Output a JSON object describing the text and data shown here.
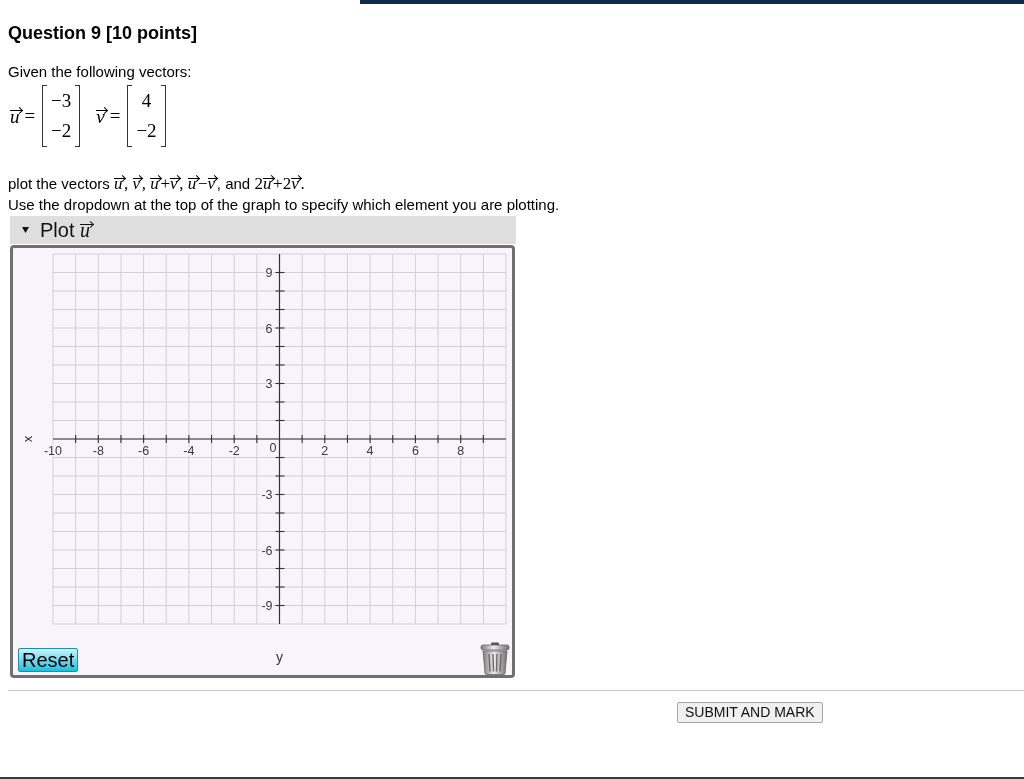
{
  "header": {
    "title": "Question 9 [10 points]"
  },
  "question": {
    "intro": "Given the following vectors:",
    "vectors": [
      {
        "name": "u",
        "sign": "=",
        "components": [
          "−3",
          "−2"
        ]
      },
      {
        "name": "v",
        "sign": "=",
        "components": [
          "4",
          "−2"
        ]
      }
    ],
    "instruction": [
      {
        "kind": "text",
        "text": "plot the vectors "
      },
      {
        "kind": "vector",
        "text": "u"
      },
      {
        "kind": "math",
        "text": ", "
      },
      {
        "kind": "vector",
        "text": "v"
      },
      {
        "kind": "math",
        "text": ", "
      },
      {
        "kind": "vector",
        "text": "u"
      },
      {
        "kind": "math",
        "text": "+"
      },
      {
        "kind": "vector",
        "text": "v"
      },
      {
        "kind": "math",
        "text": ", "
      },
      {
        "kind": "vector",
        "text": "u"
      },
      {
        "kind": "math",
        "text": "−"
      },
      {
        "kind": "vector",
        "text": "v"
      },
      {
        "kind": "text",
        "text": ", and "
      },
      {
        "kind": "math",
        "text": "2"
      },
      {
        "kind": "vector",
        "text": "u"
      },
      {
        "kind": "math",
        "text": "+2"
      },
      {
        "kind": "vector",
        "text": "v"
      },
      {
        "kind": "math",
        "text": "."
      }
    ],
    "note": "Use the dropdown at the top of the graph to specify which element you are plotting."
  },
  "graph": {
    "dropdown": {
      "label": [
        {
          "kind": "text",
          "text": "Plot "
        },
        {
          "kind": "vector",
          "text": "u"
        }
      ]
    },
    "chart_data": {
      "type": "scatter",
      "xlabel": "y",
      "ylabel": "x",
      "xlim": [
        -10,
        10
      ],
      "ylim": [
        -10,
        10
      ],
      "xticks": [
        -10,
        -8,
        -6,
        -4,
        -2,
        0,
        2,
        4,
        6,
        8
      ],
      "yticks": [
        -9,
        -6,
        -3,
        3,
        6,
        9
      ],
      "grid": true
    },
    "reset_button": "Reset"
  },
  "submit_button": "SUBMIT AND MARK"
}
